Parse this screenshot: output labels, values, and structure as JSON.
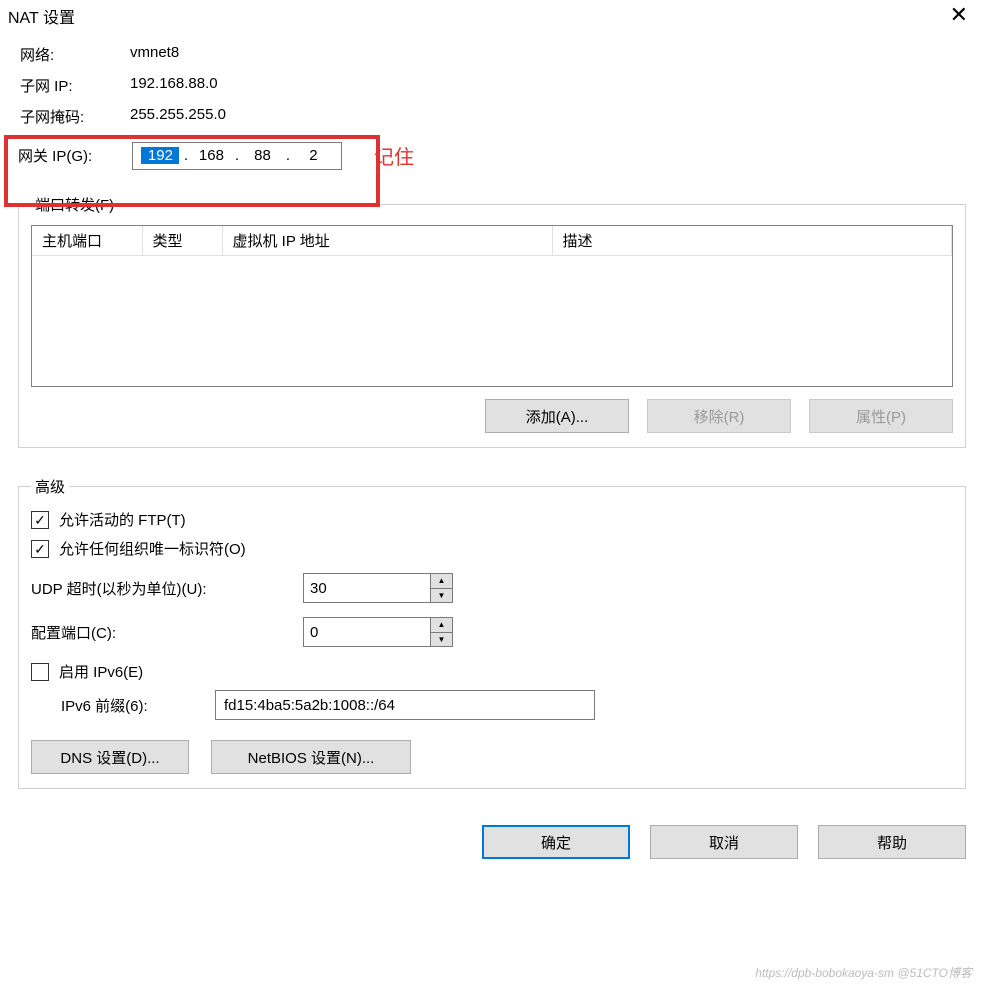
{
  "window": {
    "title": "NAT 设置"
  },
  "info": {
    "network_label": "网络:",
    "network_value": "vmnet8",
    "subnet_ip_label": "子网 IP:",
    "subnet_ip_value": "192.168.88.0",
    "subnet_mask_label": "子网掩码:",
    "subnet_mask_value": "255.255.255.0"
  },
  "gateway": {
    "label": "网关 IP(G):",
    "octet1": "192",
    "octet2": "168",
    "octet3": "88",
    "octet4": "2",
    "dot": ".",
    "annotation": "记住"
  },
  "port_forward": {
    "legend": "端口转发(F)",
    "col_host_port": "主机端口",
    "col_type": "类型",
    "col_vm_ip": "虚拟机 IP 地址",
    "col_desc": "描述",
    "add": "添加(A)...",
    "remove": "移除(R)",
    "properties": "属性(P)"
  },
  "advanced": {
    "legend": "高级",
    "allow_ftp": "允许活动的 FTP(T)",
    "allow_oui": "允许任何组织唯一标识符(O)",
    "udp_timeout_label": "UDP 超时(以秒为单位)(U):",
    "udp_timeout_value": "30",
    "config_port_label": "配置端口(C):",
    "config_port_value": "0",
    "enable_ipv6": "启用 IPv6(E)",
    "ipv6_prefix_label": "IPv6 前缀(6):",
    "ipv6_prefix_value": "fd15:4ba5:5a2b:1008::/64",
    "dns_settings": "DNS 设置(D)...",
    "netbios_settings": "NetBIOS 设置(N)..."
  },
  "footer": {
    "ok": "确定",
    "cancel": "取消",
    "help": "帮助"
  },
  "watermark": "https://dpb-bobokaoya-sm @51CTO博客"
}
